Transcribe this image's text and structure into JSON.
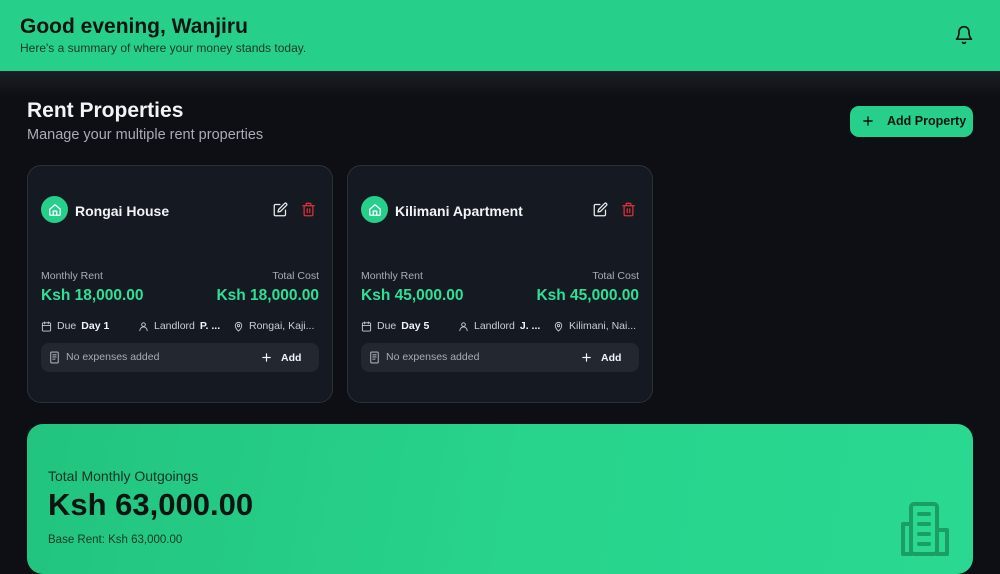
{
  "header": {
    "greeting": "Good evening, Wanjiru",
    "subtitle": "Here's a summary of where your money stands today.",
    "icon": "bell-icon"
  },
  "page": {
    "title": "Rent Properties",
    "subtitle": "Manage your multiple rent properties",
    "add_button_label": "Add Property"
  },
  "properties": [
    {
      "name": "Rongai House",
      "monthly_rent_label": "Monthly Rent",
      "monthly_rent": "Ksh 18,000.00",
      "total_cost_label": "Total Cost",
      "total_cost": "Ksh 18,000.00",
      "due_label": "Due",
      "due_value": "Day 1",
      "landlord_label": "Landlord",
      "landlord_value": "P. ...",
      "location": "Rongai, Kaji...",
      "expenses_text": "No expenses added",
      "add_label": "Add"
    },
    {
      "name": "Kilimani Apartment",
      "monthly_rent_label": "Monthly Rent",
      "monthly_rent": "Ksh 45,000.00",
      "total_cost_label": "Total Cost",
      "total_cost": "Ksh 45,000.00",
      "due_label": "Due",
      "due_value": "Day 5",
      "landlord_label": "Landlord",
      "landlord_value": "J. ...",
      "location": "Kilimani, Nai...",
      "expenses_text": "No expenses added",
      "add_label": "Add"
    }
  ],
  "summary": {
    "label": "Total Monthly Outgoings",
    "total": "Ksh 63,000.00",
    "base_rent": "Base Rent: Ksh 63,000.00",
    "icon": "building-icon"
  },
  "colors": {
    "accent": "#26d08a",
    "accent_text": "#2ee093",
    "background": "#0d0f14",
    "card": "#151922",
    "danger": "#e0313a"
  }
}
